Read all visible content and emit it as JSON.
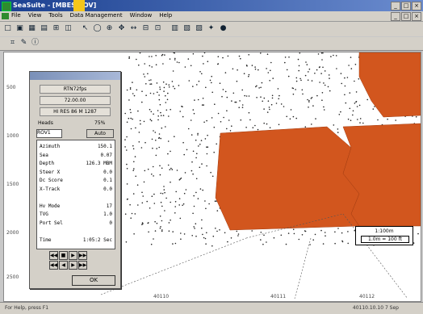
{
  "window": {
    "title": "SeaSuite - [MBES ROV]",
    "controls": [
      "_",
      "□",
      "×"
    ]
  },
  "menu": {
    "items": [
      "File",
      "View",
      "Tools",
      "Data Management",
      "Window",
      "Help"
    ],
    "mdi_controls": [
      "_",
      "□",
      "×"
    ]
  },
  "toolbar": {
    "buttons": [
      {
        "name": "new-icon",
        "glyph": "□"
      },
      {
        "name": "open-icon",
        "glyph": "▣"
      },
      {
        "name": "grid-icon",
        "glyph": "▦"
      },
      {
        "name": "save-icon",
        "glyph": "▤"
      },
      {
        "name": "print-icon",
        "glyph": "⊞"
      },
      {
        "name": "layers-icon",
        "glyph": "◫"
      },
      {
        "name": "pointer-icon",
        "glyph": "↖"
      },
      {
        "name": "select-icon",
        "glyph": "◯"
      },
      {
        "name": "zoom-icon",
        "glyph": "⊕"
      },
      {
        "name": "pan-icon",
        "glyph": "✥"
      },
      {
        "name": "measure-icon",
        "glyph": "↔"
      },
      {
        "name": "grid2-icon",
        "glyph": "⊟"
      },
      {
        "name": "profile-icon",
        "glyph": "⊡"
      },
      {
        "name": "chart-icon",
        "glyph": "▥"
      },
      {
        "name": "table-icon",
        "glyph": "▧"
      },
      {
        "name": "map-icon",
        "glyph": "▨"
      },
      {
        "name": "settings-icon",
        "glyph": "✦"
      },
      {
        "name": "record-icon",
        "glyph": "●"
      }
    ],
    "row2": [
      {
        "name": "draw-icon",
        "glyph": "⌗"
      },
      {
        "name": "edit-icon",
        "glyph": "✎"
      },
      {
        "name": "info-icon",
        "glyph": "ⓘ"
      }
    ]
  },
  "panel": {
    "field1": "RTN72fps",
    "field2": "72.00.00",
    "field3": "HI RES 86 M 1287",
    "row1": {
      "label": "Heads",
      "value": "75%"
    },
    "row2": {
      "label": "ROV1",
      "button": "Auto"
    },
    "readout": [
      {
        "label": "Azimuth",
        "value": "150.1"
      },
      {
        "label": "Sea",
        "value": "0.07"
      },
      {
        "label": "Depth",
        "value": "126.3 MBM"
      },
      {
        "label": "Steer X",
        "value": "0.0"
      },
      {
        "label": "Dc Score",
        "value": "0.1"
      },
      {
        "label": "X-Track",
        "value": "0.0"
      },
      {
        "label": "",
        "value": ""
      },
      {
        "label": "Hv Mode",
        "value": "17"
      },
      {
        "label": "TVG",
        "value": "1.0"
      },
      {
        "label": "Port Sel",
        "value": "0"
      },
      {
        "label": "",
        "value": ""
      },
      {
        "label": "Time",
        "value": "1:05:2 Sec"
      }
    ],
    "playback_row1": [
      "◀◀",
      "■",
      "▶",
      "▶▶"
    ],
    "playback_row2": [
      "◀◀",
      "◀",
      "▶",
      "▶▶"
    ],
    "ok_label": "OK"
  },
  "plot": {
    "y_labels": [
      "500",
      "1000",
      "1500",
      "2000",
      "2500"
    ],
    "x_labels": [
      "40110",
      "40111",
      "40112"
    ],
    "legend_line1": "1:100m",
    "legend_line2": "1.0m = 100 ft",
    "coverage_color": "#d2561e",
    "sounding_color": "#222222"
  },
  "status": {
    "left": "For Help, press F1",
    "right": "40110.10.10 7 Sep"
  }
}
